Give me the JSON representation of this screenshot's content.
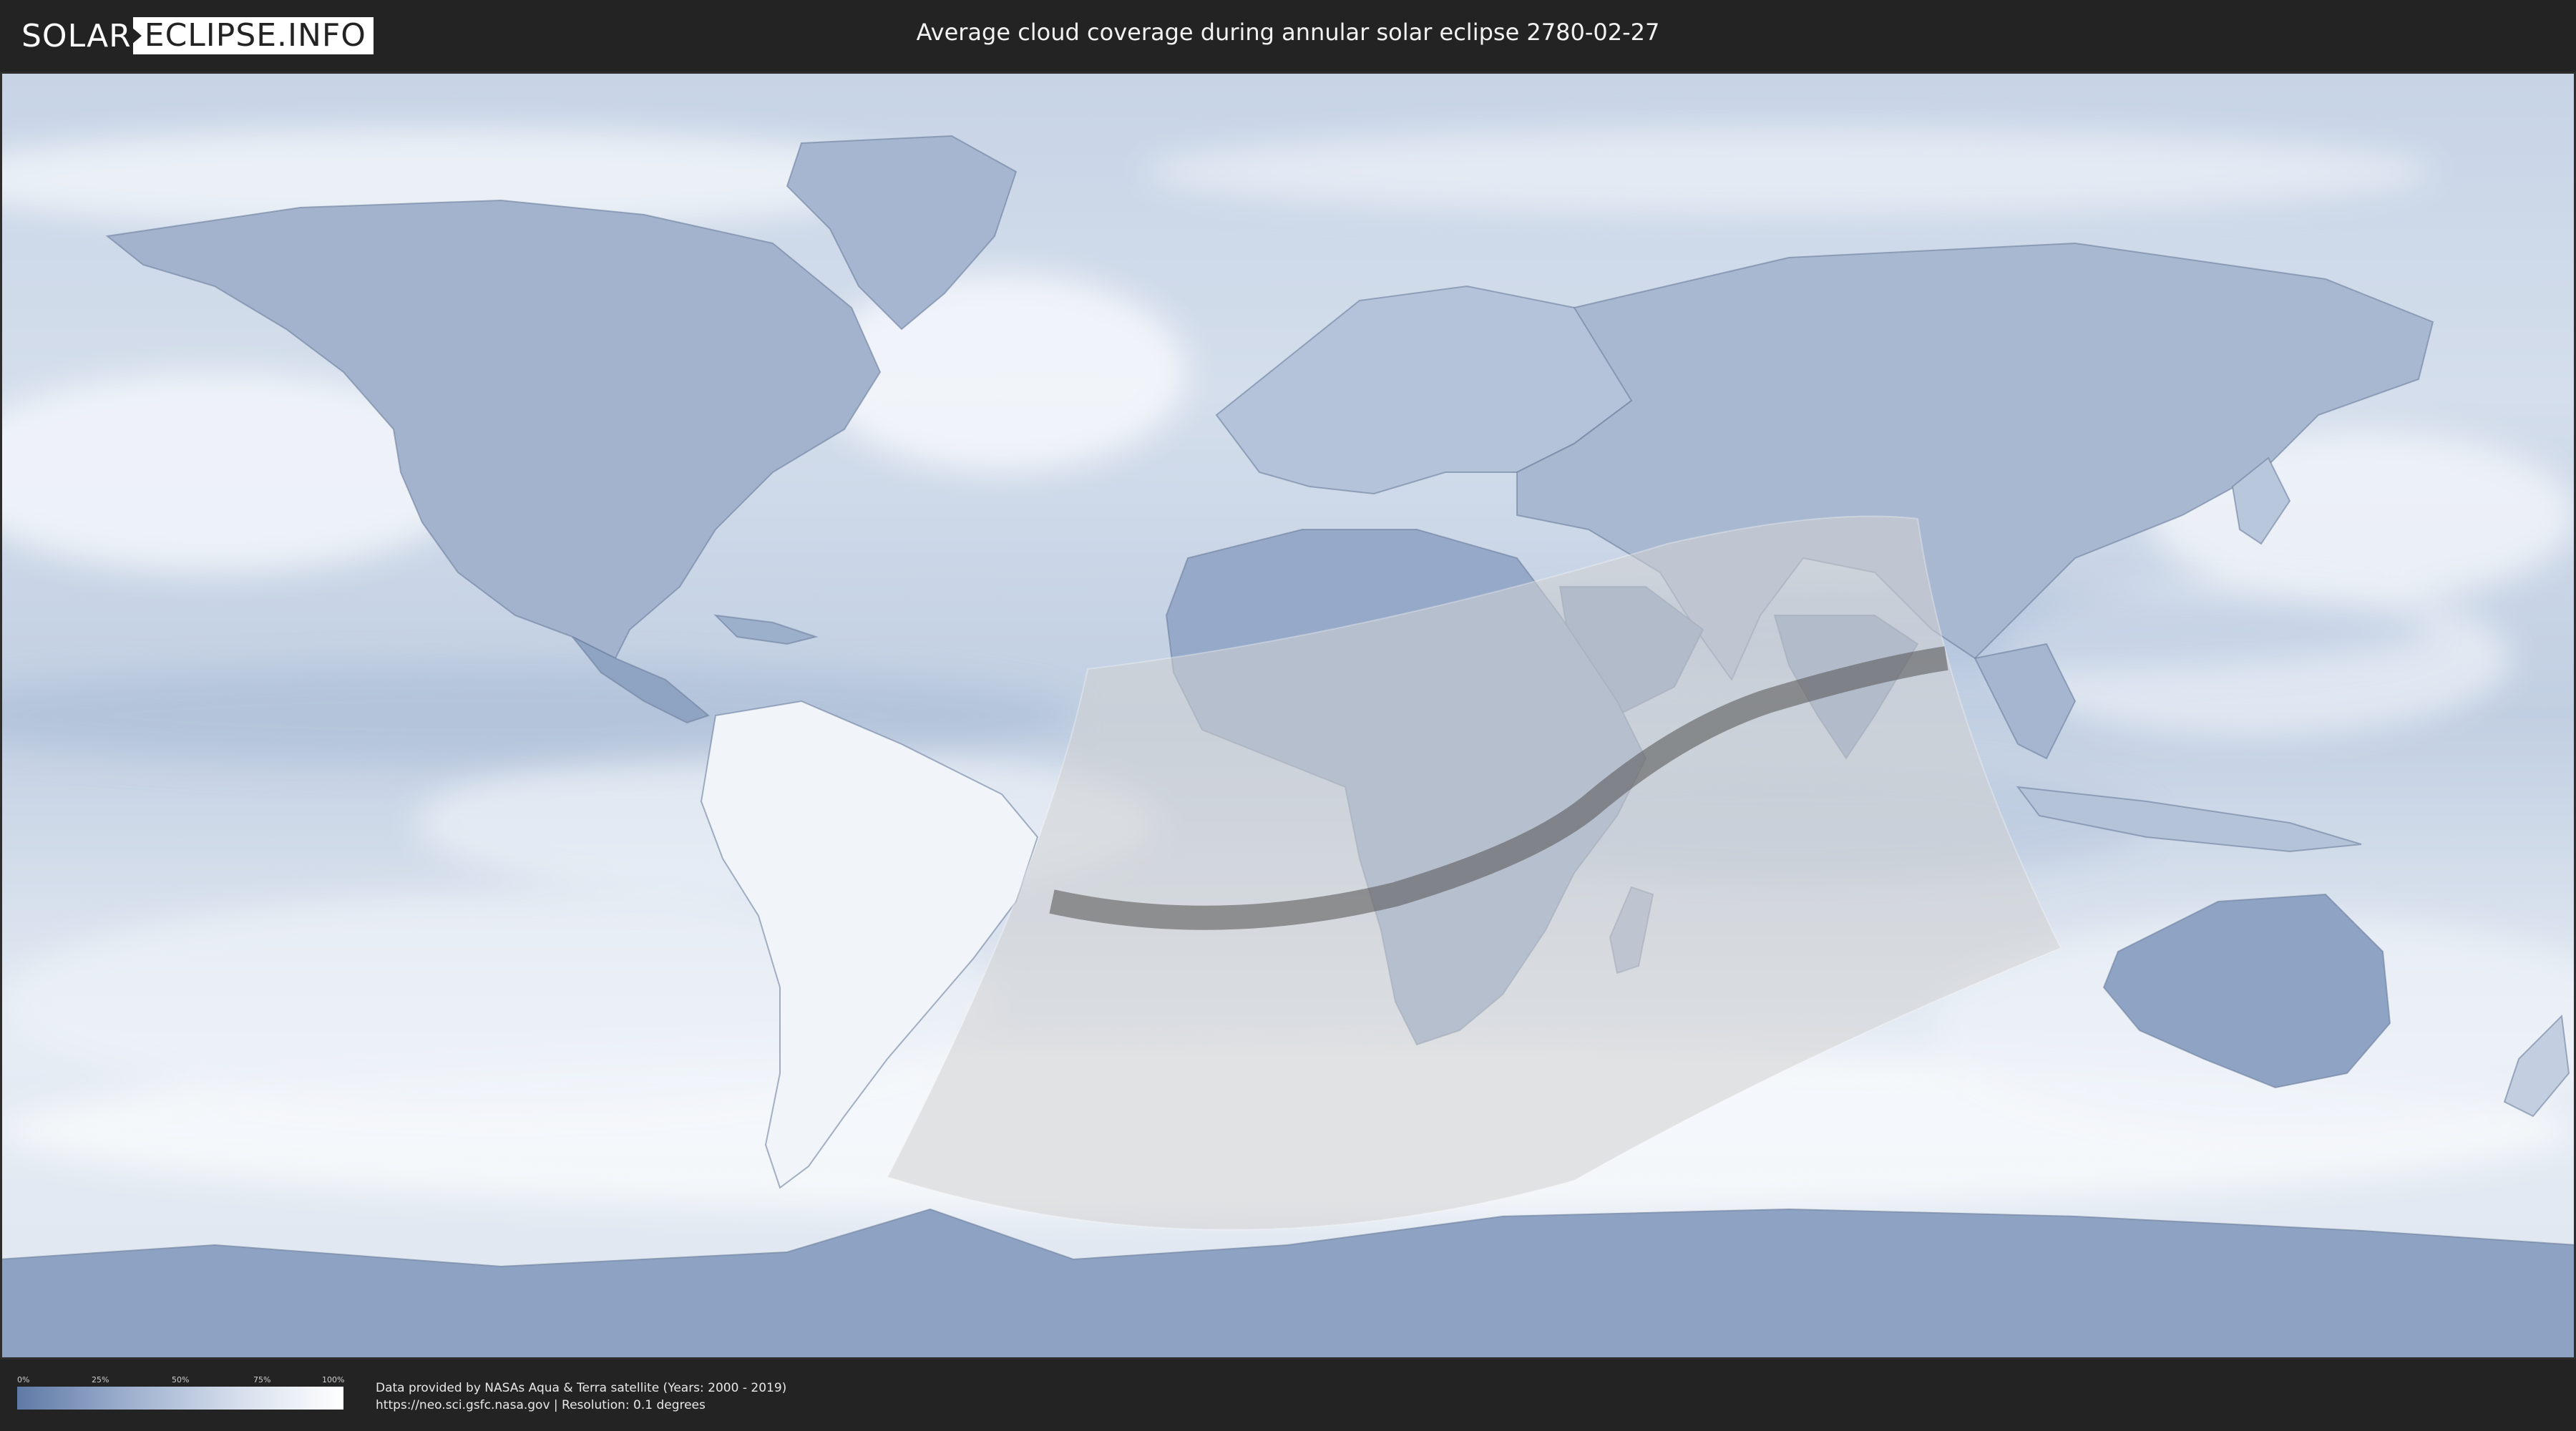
{
  "header": {
    "logo_left": "SOLAR",
    "logo_right": "ECLIPSE.INFO",
    "title": "Average cloud coverage during annular solar eclipse 2780-02-27"
  },
  "map": {
    "ocean_color": "#bccbe0",
    "land_color": "#8ea3c4",
    "cloud_color": "#f4f6fa",
    "eclipse_zone_color": "#d9d9d9",
    "annular_path_color": "#6e6e6e"
  },
  "legend": {
    "ticks": [
      "0%",
      "25%",
      "50%",
      "75%",
      "100%"
    ],
    "colors": [
      "#5f7aa6",
      "#ffffff"
    ]
  },
  "footer": {
    "source_line1": "Data provided by NASAs Aqua & Terra satellite (Years: 2000 - 2019)",
    "source_line2": "https://neo.sci.gsfc.nasa.gov | Resolution: 0.1 degrees"
  }
}
